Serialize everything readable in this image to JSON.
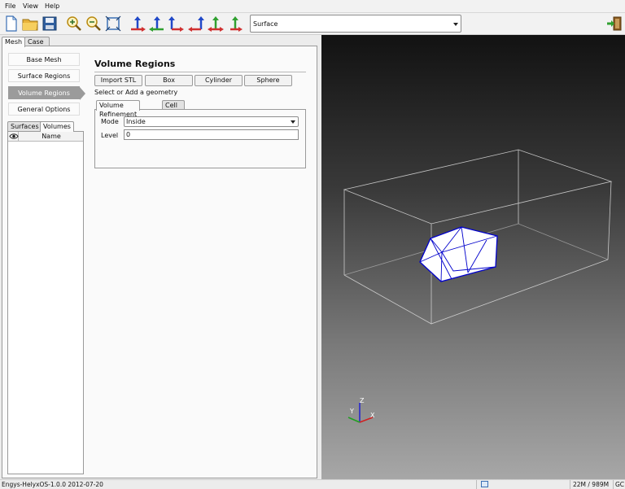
{
  "menu": {
    "file": "File",
    "view": "View",
    "help": "Help"
  },
  "toolbar": {
    "view_mode": "Surface"
  },
  "outer_tabs": {
    "mesh": "Mesh",
    "case_setup": "Case Setup"
  },
  "nav": {
    "base_mesh": "Base Mesh",
    "surface_regions": "Surface Regions",
    "volume_regions": "Volume Regions",
    "general_options": "General Options"
  },
  "inner_tabs": {
    "surfaces": "Surfaces",
    "volumes": "Volumes"
  },
  "tree": {
    "name_header": "Name"
  },
  "volume": {
    "title": "Volume Regions",
    "buttons": {
      "import_stl": "Import STL",
      "box": "Box",
      "cylinder": "Cylinder",
      "sphere": "Sphere"
    },
    "hint": "Select or Add a geometry",
    "tabs": {
      "refinement": "Volume Refinement",
      "cell_zone": "Cell Zone"
    },
    "mode_label": "Mode",
    "mode_value": "Inside",
    "level_label": "Level",
    "level_value": "0"
  },
  "axes": {
    "x": "X",
    "y": "Y",
    "z": "Z"
  },
  "status": {
    "version": "Engys-HelyxOS-1.0.0 2012-07-20",
    "memory": "22M / 989M",
    "gc": "GC"
  },
  "colors": {
    "mesh_wire": "#0000cc",
    "axis_x": "#d02020",
    "axis_y": "#20a020",
    "axis_z": "#2020d0",
    "nav_active": "#9b9b9b"
  }
}
